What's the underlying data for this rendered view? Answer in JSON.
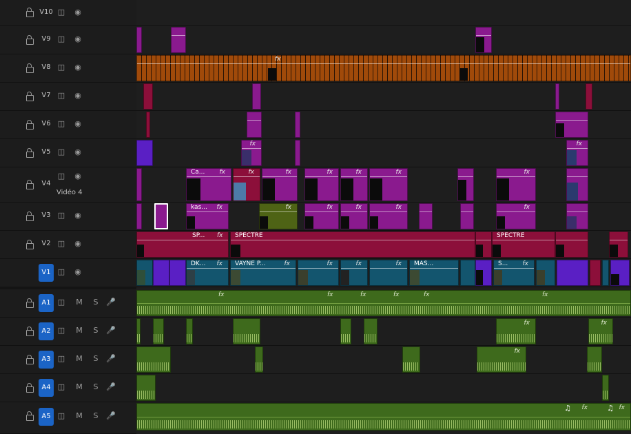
{
  "tracks": {
    "video": [
      {
        "id": "V10",
        "label": "V10",
        "targeted": false
      },
      {
        "id": "V9",
        "label": "V9",
        "targeted": false
      },
      {
        "id": "V8",
        "label": "V8",
        "targeted": false
      },
      {
        "id": "V7",
        "label": "V7",
        "targeted": false
      },
      {
        "id": "V6",
        "label": "V6",
        "targeted": false
      },
      {
        "id": "V5",
        "label": "V5",
        "targeted": false
      },
      {
        "id": "V4",
        "label": "V4",
        "targeted": false,
        "name": "Vidéo 4"
      },
      {
        "id": "V3",
        "label": "V3",
        "targeted": false
      },
      {
        "id": "V2",
        "label": "V2",
        "targeted": false
      },
      {
        "id": "V1",
        "label": "V1",
        "targeted": true
      }
    ],
    "audio": [
      {
        "id": "A1",
        "label": "A1",
        "targeted": true,
        "mute": "M",
        "solo": "S"
      },
      {
        "id": "A2",
        "label": "A2",
        "targeted": true,
        "mute": "M",
        "solo": "S"
      },
      {
        "id": "A3",
        "label": "A3",
        "targeted": true,
        "mute": "M",
        "solo": "S"
      },
      {
        "id": "A4",
        "label": "A4",
        "targeted": true,
        "mute": "M",
        "solo": "S"
      },
      {
        "id": "A5",
        "label": "A5",
        "targeted": true,
        "mute": "M",
        "solo": "S"
      }
    ]
  },
  "clip_titles": {
    "v4_ca": "Ca...",
    "v3_kas": "kas...",
    "v2_sp": "SP...",
    "v2_spectre": "SPECTRE",
    "v2_spectre2": "SPECTRE",
    "v1_dk": "DK...",
    "v1_vayne": "VAYNE P...",
    "v1_mas": "MAS...",
    "v1_s": "S..."
  },
  "fx_label": "fx",
  "icons": {
    "lock": "lock-icon",
    "film": "film-icon",
    "eye": "eye-icon",
    "mic": "microphone-icon",
    "note": "music-note-icon",
    "star": "sparkle-icon"
  },
  "colors": {
    "magenta": "#8a1a8e",
    "violet": "#5a1fc4",
    "orange": "#a04a0a",
    "crimson": "#8c0f3a",
    "olive": "#4e6315",
    "teal": "#13556e",
    "audio_green": "#3e6a1c",
    "track_target": "#1b64c6"
  }
}
